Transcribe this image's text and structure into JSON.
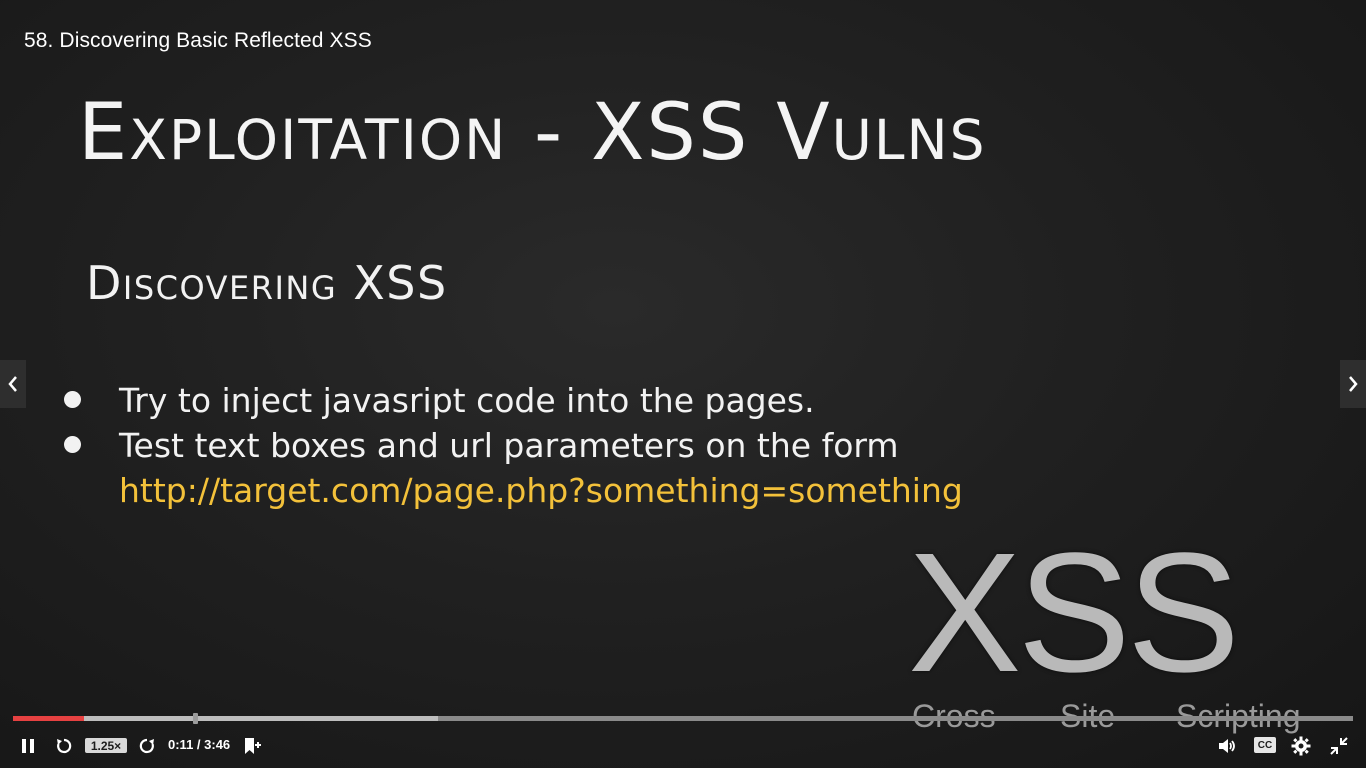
{
  "video": {
    "title": "58. Discovering Basic Reflected XSS"
  },
  "slide": {
    "heading": "Exploitation - XSS Vulns",
    "subheading": "Discovering XSS",
    "bullets": [
      "Try to inject javasript code into the pages.",
      "Test text boxes and url parameters on the form"
    ],
    "example_url": "http://target.com/page.php?something=something",
    "logo": {
      "big": "XSS",
      "words": [
        "Cross",
        "Site",
        "Scripting"
      ]
    }
  },
  "player": {
    "progress_played": 0.053,
    "progress_buffered": 0.317,
    "speed": "1.25×",
    "time": "0:11 / 3:46",
    "cc": "CC",
    "colors": {
      "played": "#e64141",
      "link": "#f3c13a"
    },
    "icons": [
      "pause-icon",
      "rewind-icon",
      "forward-icon",
      "bookmark-add-icon",
      "volume-icon",
      "settings-icon",
      "exit-fullscreen-icon",
      "chevron-left-icon",
      "chevron-right-icon"
    ]
  }
}
